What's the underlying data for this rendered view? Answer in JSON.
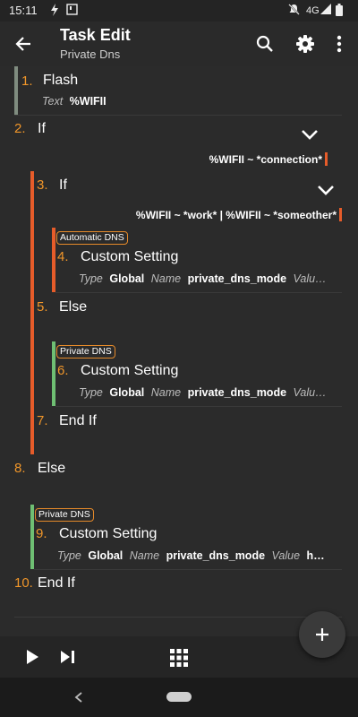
{
  "status": {
    "time": "15:11",
    "network": "4G"
  },
  "appbar": {
    "title": "Task Edit",
    "subtitle": "Private Dns"
  },
  "actions": [
    {
      "num": "1.",
      "name": "Flash",
      "args": [
        {
          "k": "Text",
          "v": "%WIFII"
        }
      ]
    },
    {
      "num": "2.",
      "name": "If",
      "condition": "%WIFII ~ *connection*"
    },
    {
      "num": "3.",
      "name": "If",
      "condition": "%WIFII ~ *work* | %WIFII ~ *someother*"
    },
    {
      "num": "4.",
      "name": "Custom Setting",
      "label": "Automatic DNS",
      "args": [
        {
          "k": "Type",
          "v": "Global"
        },
        {
          "k": "Name",
          "v": "private_dns_mode"
        },
        {
          "k": "Valu…",
          "v": ""
        }
      ]
    },
    {
      "num": "5.",
      "name": "Else"
    },
    {
      "num": "6.",
      "name": "Custom Setting",
      "label": "Private DNS",
      "args": [
        {
          "k": "Type",
          "v": "Global"
        },
        {
          "k": "Name",
          "v": "private_dns_mode"
        },
        {
          "k": "Valu…",
          "v": ""
        }
      ]
    },
    {
      "num": "7.",
      "name": "End If"
    },
    {
      "num": "8.",
      "name": "Else"
    },
    {
      "num": "9.",
      "name": "Custom Setting",
      "label": "Private DNS",
      "args": [
        {
          "k": "Type",
          "v": "Global"
        },
        {
          "k": "Name",
          "v": "private_dns_mode"
        },
        {
          "k": "Value",
          "v": "h…"
        }
      ]
    },
    {
      "num": "10.",
      "name": "End If"
    }
  ],
  "icons": {
    "back": "arrow-left-icon",
    "search": "search-icon",
    "settings": "gear-icon",
    "more": "more-vert-icon",
    "play": "play-icon",
    "step": "skip-next-icon",
    "grid": "grid-icon",
    "add": "plus-icon",
    "nav_back": "chevron-left-icon",
    "home": "home-pill"
  },
  "colors": {
    "orange": "#f0962a",
    "red_bar": "#e65c2a",
    "green_bar": "#6fbf73",
    "flash_bar": "#7f8c7f"
  }
}
